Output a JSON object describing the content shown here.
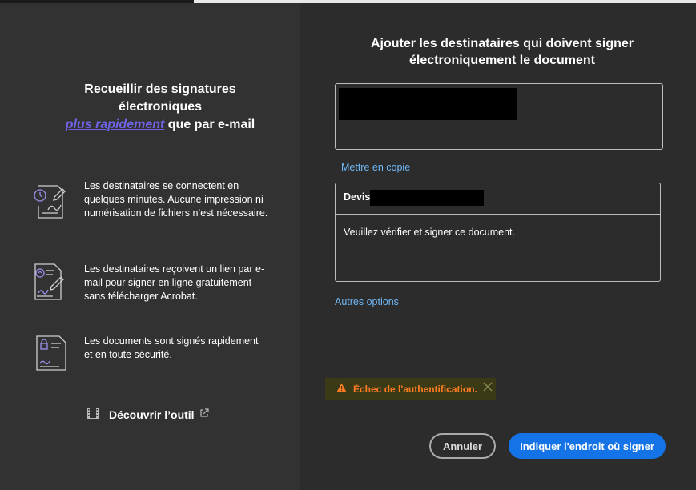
{
  "left_panel": {
    "title_line1": "Recueillir des signatures",
    "title_line2": "électroniques",
    "title_accent": "plus rapidement",
    "title_rest": " que par e-mail",
    "features": [
      {
        "icon": "signing-speed-icon",
        "text": "Les destinataires se connectent en quelques minutes. Aucune impression ni numérisation de fichiers n’est nécessaire."
      },
      {
        "icon": "email-sign-document-icon",
        "text": "Les destinataires reçoivent un lien par e-mail pour signer en ligne gratuitement sans télécharger Acrobat."
      },
      {
        "icon": "secure-document-icon",
        "text": "Les documents sont signés rapidement et en toute sécurité."
      }
    ],
    "discover_label": "Découvrir l’outil",
    "discover_icon": "film-icon",
    "external_icon": "external-link-icon"
  },
  "right_panel": {
    "title_line1": "Ajouter les destinataires qui doivent signer",
    "title_line2": "électroniquement le document",
    "cc_link": "Mettre en copie",
    "subject_prefix": "Devis",
    "message": "Veuillez vérifier et signer ce document.",
    "more_options_link": "Autres options",
    "error_text": "Échec de l'authentification.",
    "cancel_label": "Annuler",
    "primary_label": "Indiquer l'endroit où signer"
  },
  "colors": {
    "accent_purple": "#6f63e6",
    "link_blue": "#6fb8f5",
    "primary_blue": "#1473e6",
    "error_orange": "#ff7b22"
  }
}
